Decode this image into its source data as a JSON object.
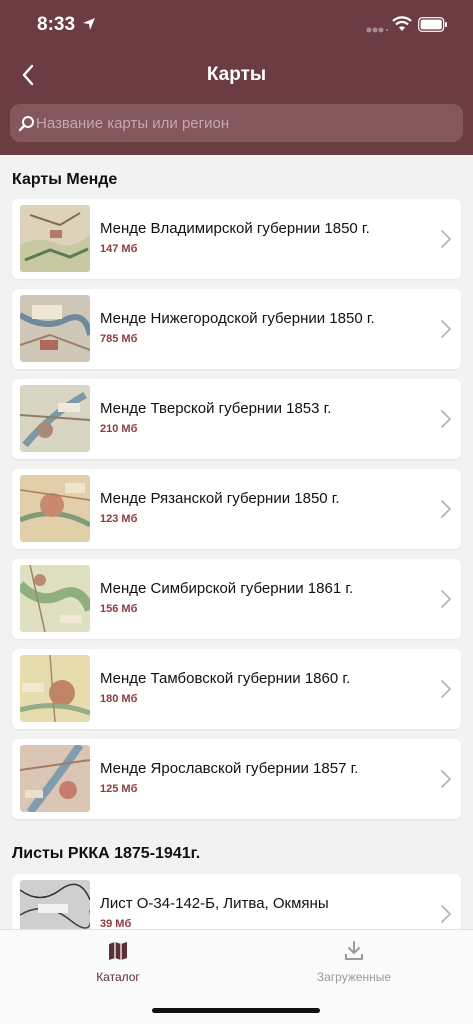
{
  "status_bar": {
    "time": "8:33"
  },
  "nav": {
    "title": "Карты"
  },
  "search": {
    "placeholder": "Название карты или регион"
  },
  "sections": [
    {
      "title": "Карты Менде",
      "items": [
        {
          "title": "Менде Владимирской губернии 1850 г.",
          "size": "147 Мб"
        },
        {
          "title": "Менде Нижегородской губернии 1850 г.",
          "size": "785 Мб"
        },
        {
          "title": "Менде Тверской губернии 1853 г.",
          "size": "210 Мб"
        },
        {
          "title": "Менде Рязанской губернии 1850 г.",
          "size": "123 Мб"
        },
        {
          "title": "Менде Симбирской губернии 1861 г.",
          "size": "156 Мб"
        },
        {
          "title": "Менде Тамбовской губернии 1860 г.",
          "size": "180 Мб"
        },
        {
          "title": "Менде Ярославской губернии 1857 г.",
          "size": "125 Мб"
        }
      ]
    },
    {
      "title": "Листы РККА 1875-1941г.",
      "items": [
        {
          "title": "Лист О-34-142-Б, Литва, Окмяны",
          "size": "39 Мб"
        }
      ]
    }
  ],
  "tabs": [
    {
      "label": "Каталог",
      "icon": "map-icon",
      "active": true
    },
    {
      "label": "Загруженные",
      "icon": "download-icon",
      "active": false
    }
  ],
  "colors": {
    "header": "#6b3c42",
    "accent": "#8c3b41",
    "tab_active": "#5b2f35",
    "tab_inactive": "#9a9a9a"
  }
}
